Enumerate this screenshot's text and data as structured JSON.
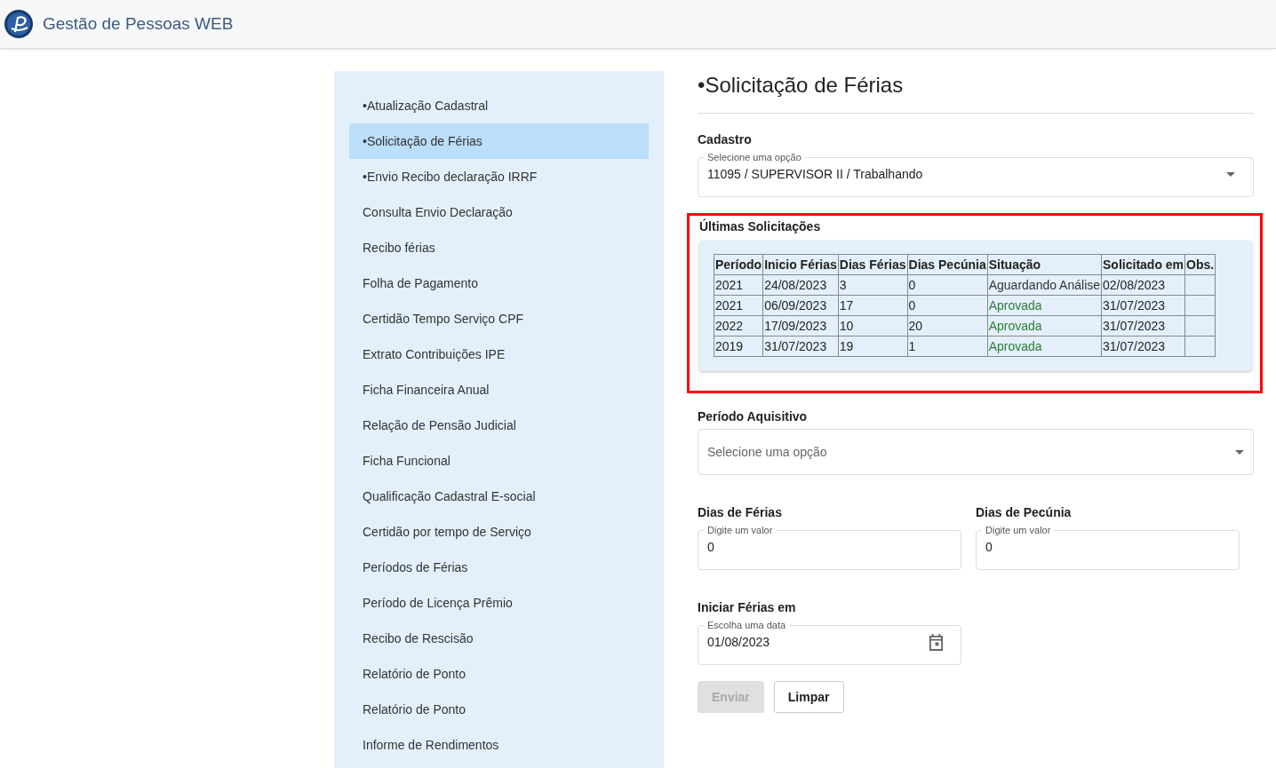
{
  "header": {
    "title": "Gestão de Pessoas WEB"
  },
  "sidebar": {
    "items": [
      {
        "label": "•Atualização Cadastral",
        "selected": false
      },
      {
        "label": "•Solicitação de Férias",
        "selected": true
      },
      {
        "label": "•Envio Recibo declaração IRRF",
        "selected": false
      },
      {
        "label": "Consulta Envio Declaração",
        "selected": false
      },
      {
        "label": "Recibo férias",
        "selected": false
      },
      {
        "label": "Folha de Pagamento",
        "selected": false
      },
      {
        "label": "Certidão Tempo Serviço CPF",
        "selected": false
      },
      {
        "label": "Extrato Contribuições IPE",
        "selected": false
      },
      {
        "label": "Ficha Financeira Anual",
        "selected": false
      },
      {
        "label": "Relação de Pensão Judicial",
        "selected": false
      },
      {
        "label": "Ficha Funcional",
        "selected": false
      },
      {
        "label": "Qualificação Cadastral E-social",
        "selected": false
      },
      {
        "label": "Certidão por tempo de Serviço",
        "selected": false
      },
      {
        "label": "Períodos de Férias",
        "selected": false
      },
      {
        "label": "Período de Licença Prêmio",
        "selected": false
      },
      {
        "label": "Recibo de Rescisão",
        "selected": false
      },
      {
        "label": "Relatório de Ponto",
        "selected": false
      },
      {
        "label": "Relatório de Ponto",
        "selected": false
      },
      {
        "label": "Informe de Rendimentos",
        "selected": false
      }
    ]
  },
  "page": {
    "title": "•Solicitação de Férias"
  },
  "cadastro": {
    "label": "Cadastro",
    "floating_label": "Selecione uma opção",
    "value": "11095 / SUPERVISOR II / Trabalhando"
  },
  "requests": {
    "title": "Últimas Solicitações",
    "highlighted": true,
    "columns": [
      "Período",
      "Inicio Férias",
      "Dias Férias",
      "Dias Pecúnia",
      "Situação",
      "Solicitado em",
      "Obs."
    ],
    "rows": [
      {
        "cells": [
          "2021",
          "24/08/2023",
          "3",
          "0",
          "Aguardando Análise",
          "02/08/2023",
          null
        ],
        "kind": "pending"
      },
      {
        "cells": [
          "2021",
          "06/09/2023",
          "17",
          "0",
          "Aprovada",
          "31/07/2023",
          null
        ],
        "kind": "approved"
      },
      {
        "cells": [
          "2022",
          "17/09/2023",
          "10",
          "20",
          "Aprovada",
          "31/07/2023",
          null
        ],
        "kind": "approved"
      },
      {
        "cells": [
          "2019",
          "31/07/2023",
          "19",
          "1",
          "Aprovada",
          "31/07/2023",
          null
        ],
        "kind": "approved"
      }
    ]
  },
  "periodo": {
    "label": "Período Aquisitivo",
    "placeholder": "Selecione uma opção"
  },
  "dias_ferias": {
    "label": "Dias de Férias",
    "floating_label": "Digite um valor",
    "value": "0"
  },
  "dias_pecunia": {
    "label": "Dias de Pecúnia",
    "floating_label": "Digite um valor",
    "value": "0"
  },
  "inicio": {
    "label": "Iniciar Férias em",
    "floating_label": "Escolha uma data",
    "value": "01/08/2023"
  },
  "buttons": [
    {
      "label": "Enviar",
      "disabled": true
    },
    {
      "label": "Limpar",
      "disabled": false
    }
  ]
}
